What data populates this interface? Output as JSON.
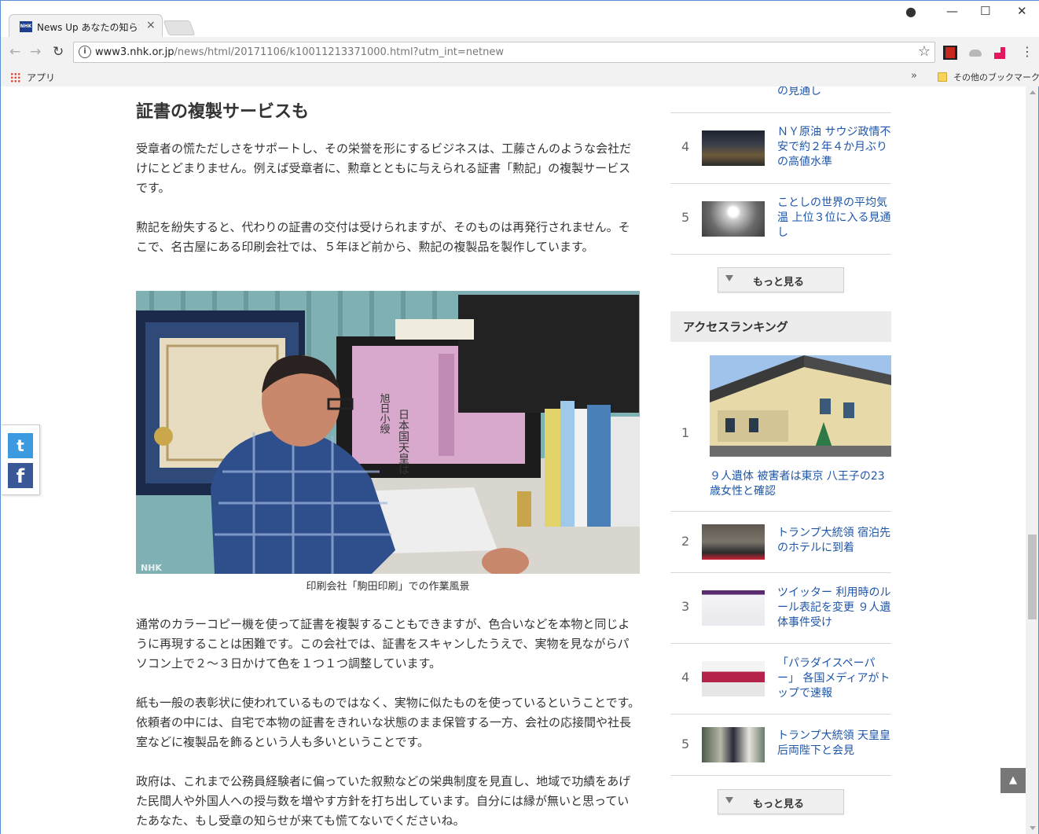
{
  "browser": {
    "tab_title": "News Up あなたの知らない",
    "tab_favicon_text": "NHK",
    "url_host": "www3.nhk.or.jp",
    "url_path": "/news/html/20171106/k10011213371000.html?utm_int=netnew",
    "bookmark_apps": "アプリ",
    "bookmark_more": "»",
    "bookmark_other": "その他のブックマーク"
  },
  "article": {
    "heading": "証書の複製サービスも",
    "paragraphs": [
      "受章者の慌ただしさをサポートし、その栄誉を形にするビジネスは、工藤さんのような会社だけにとどまりません。例えば受章者に、勲章とともに与えられる証書「勲記」の複製サービスです。",
      "勲記を紛失すると、代わりの証書の交付は受けられますが、そのものは再発行されません。そこで、名古屋にある印刷会社では、５年ほど前から、勲記の複製品を製作しています。",
      "通常のカラーコピー機を使って証書を複製することもできますが、色合いなどを本物と同じように再現することは困難です。この会社では、証書をスキャンしたうえで、実物を見ながらパソコン上で２～３日かけて色を１つ１つ調整しています。",
      "紙も一般の表彰状に使われているものではなく、実物に似たものを使っているということです。依頼者の中には、自宅で本物の証書をきれいな状態のまま保管する一方、会社の応接間や社長室などに複製品を飾るという人も多いということです。",
      "政府は、これまで公務員経験者に偏っていた叙勲などの栄典制度を見直し、地域で功績をあげた民間人や外国人への授与数を増やす方針を打ち出しています。自分には縁が無いと思っていたあなた、もし受章の知らせが来ても慌てないでくださいね。"
    ],
    "photo_caption": "印刷会社「駒田印刷」での作業風景",
    "photo_watermark": "NHK",
    "photo_certificate_text": "日本国天皇は",
    "photo_certificate_name": "旭日小綬"
  },
  "sidebar": {
    "top_list": [
      {
        "rank": "",
        "title": "の見通し"
      },
      {
        "rank": "4",
        "title": "ＮＹ原油 サウジ政情不安で約２年４か月ぶりの高値水準"
      },
      {
        "rank": "5",
        "title": "ことしの世界の平均気温 上位３位に入る見通し"
      }
    ],
    "more_label": "もっと見る",
    "access_ranking_title": "アクセスランキング",
    "access_list": [
      {
        "rank": "1",
        "title": "９人遺体 被害者は東京 八王子の23歳女性と確認"
      },
      {
        "rank": "2",
        "title": "トランプ大統領 宿泊先のホテルに到着"
      },
      {
        "rank": "3",
        "title": "ツイッター 利用時のルール表記を変更 ９人遺体事件受け"
      },
      {
        "rank": "4",
        "title": "「パラダイスペーパー」 各国メディアがトップで速報"
      },
      {
        "rank": "5",
        "title": "トランプ大統領 天皇皇后両陛下と会見"
      }
    ],
    "more_label_2": "もっと見る"
  },
  "page_top_icon": "▲",
  "colors": {
    "link": "#1e56a8",
    "twitter": "#3b9ae0",
    "facebook": "#3a5897"
  }
}
